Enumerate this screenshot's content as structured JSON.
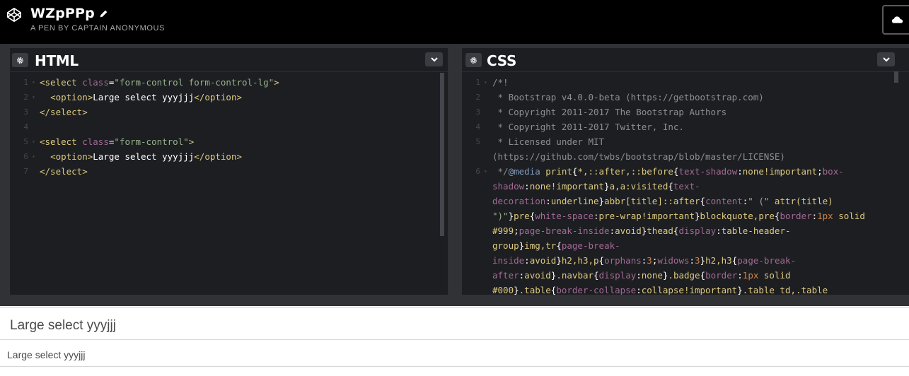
{
  "header": {
    "title": "WZpPPp",
    "subtitle": "A PEN BY CAPTAIN ANONYMOUS"
  },
  "html_pane": {
    "title": "HTML",
    "lines": [
      {
        "n": "1",
        "fold": "▾",
        "segs": [
          [
            "tag",
            "<select "
          ],
          [
            "attr",
            "class"
          ],
          [
            "plain",
            "="
          ],
          [
            "val",
            "\"form-control form-control-lg\""
          ],
          [
            "tag",
            ">"
          ]
        ]
      },
      {
        "n": "2",
        "fold": "▾",
        "segs": [
          [
            "plain",
            "  "
          ],
          [
            "tag",
            "<option>"
          ],
          [
            "plain",
            "Large select yyyjjj"
          ],
          [
            "tag",
            "</option>"
          ]
        ]
      },
      {
        "n": "3",
        "fold": "",
        "segs": [
          [
            "tag",
            "</select>"
          ]
        ]
      },
      {
        "n": "4",
        "fold": "",
        "segs": []
      },
      {
        "n": "5",
        "fold": "▾",
        "segs": [
          [
            "tag",
            "<select "
          ],
          [
            "attr",
            "class"
          ],
          [
            "plain",
            "="
          ],
          [
            "val",
            "\"form-control\""
          ],
          [
            "tag",
            ">"
          ]
        ]
      },
      {
        "n": "6",
        "fold": "▾",
        "segs": [
          [
            "plain",
            "  "
          ],
          [
            "tag",
            "<option>"
          ],
          [
            "plain",
            "Large select yyyjjj"
          ],
          [
            "tag",
            "</option>"
          ]
        ]
      },
      {
        "n": "7",
        "fold": "",
        "segs": [
          [
            "tag",
            "</select>"
          ]
        ]
      }
    ]
  },
  "css_pane": {
    "title": "CSS",
    "lines": [
      {
        "n": "1",
        "fold": "▾",
        "segs": [
          [
            "com",
            "/*!"
          ]
        ]
      },
      {
        "n": "2",
        "fold": "",
        "segs": [
          [
            "com",
            " * Bootstrap v4.0.0-beta (https://getbootstrap.com)"
          ]
        ]
      },
      {
        "n": "3",
        "fold": "",
        "segs": [
          [
            "com",
            " * Copyright 2011-2017 The Bootstrap Authors"
          ]
        ]
      },
      {
        "n": "4",
        "fold": "",
        "segs": [
          [
            "com",
            " * Copyright 2011-2017 Twitter, Inc."
          ]
        ]
      },
      {
        "n": "5",
        "fold": "",
        "segs": [
          [
            "com",
            " * Licensed under MIT"
          ]
        ]
      },
      {
        "n": "",
        "fold": "",
        "segs": [
          [
            "com",
            "(https://github.com/twbs/bootstrap/blob/master/LICENSE)"
          ]
        ]
      },
      {
        "n": "6",
        "fold": "▾",
        "segs": [
          [
            "com",
            " */"
          ],
          [
            "kw",
            "@media"
          ],
          [
            "plain",
            " "
          ],
          [
            "sel",
            "print"
          ],
          [
            "plain",
            "{"
          ],
          [
            "sel",
            "*,::after,::before"
          ],
          [
            "plain",
            "{"
          ],
          [
            "prop",
            "text-shadow"
          ],
          [
            "plain",
            ":"
          ],
          [
            "sel",
            "none!important"
          ],
          [
            "plain",
            ";"
          ],
          [
            "prop",
            "box-"
          ]
        ]
      },
      {
        "n": "",
        "fold": "",
        "segs": [
          [
            "prop",
            "shadow"
          ],
          [
            "plain",
            ":"
          ],
          [
            "sel",
            "none!important"
          ],
          [
            "plain",
            "}"
          ],
          [
            "sel",
            "a,a:visited"
          ],
          [
            "plain",
            "{"
          ],
          [
            "prop",
            "text-"
          ]
        ]
      },
      {
        "n": "",
        "fold": "",
        "segs": [
          [
            "prop",
            "decoration"
          ],
          [
            "plain",
            ":"
          ],
          [
            "sel",
            "underline"
          ],
          [
            "plain",
            "}"
          ],
          [
            "sel",
            "abbr[title]::after"
          ],
          [
            "plain",
            "{"
          ],
          [
            "prop",
            "content"
          ],
          [
            "plain",
            ":"
          ],
          [
            "val",
            "\" (\""
          ],
          [
            "plain",
            " "
          ],
          [
            "sel",
            "attr(title)"
          ]
        ]
      },
      {
        "n": "",
        "fold": "",
        "segs": [
          [
            "val",
            "\")\""
          ],
          [
            "plain",
            "}"
          ],
          [
            "sel",
            "pre"
          ],
          [
            "plain",
            "{"
          ],
          [
            "prop",
            "white-space"
          ],
          [
            "plain",
            ":"
          ],
          [
            "sel",
            "pre-wrap!important"
          ],
          [
            "plain",
            "}"
          ],
          [
            "sel",
            "blockquote,pre"
          ],
          [
            "plain",
            "{"
          ],
          [
            "prop",
            "border"
          ],
          [
            "plain",
            ":"
          ],
          [
            "num",
            "1px"
          ],
          [
            "plain",
            " "
          ],
          [
            "sel",
            "solid"
          ]
        ]
      },
      {
        "n": "",
        "fold": "",
        "segs": [
          [
            "sel",
            "#999"
          ],
          [
            "plain",
            ";"
          ],
          [
            "prop",
            "page-break-inside"
          ],
          [
            "plain",
            ":"
          ],
          [
            "sel",
            "avoid"
          ],
          [
            "plain",
            "}"
          ],
          [
            "sel",
            "thead"
          ],
          [
            "plain",
            "{"
          ],
          [
            "prop",
            "display"
          ],
          [
            "plain",
            ":"
          ],
          [
            "sel",
            "table-header-"
          ]
        ]
      },
      {
        "n": "",
        "fold": "",
        "segs": [
          [
            "sel",
            "group"
          ],
          [
            "plain",
            "}"
          ],
          [
            "sel",
            "img,tr"
          ],
          [
            "plain",
            "{"
          ],
          [
            "prop",
            "page-break-"
          ]
        ]
      },
      {
        "n": "",
        "fold": "",
        "segs": [
          [
            "prop",
            "inside"
          ],
          [
            "plain",
            ":"
          ],
          [
            "sel",
            "avoid"
          ],
          [
            "plain",
            "}"
          ],
          [
            "sel",
            "h2,h3,p"
          ],
          [
            "plain",
            "{"
          ],
          [
            "prop",
            "orphans"
          ],
          [
            "plain",
            ":"
          ],
          [
            "num",
            "3"
          ],
          [
            "plain",
            ";"
          ],
          [
            "prop",
            "widows"
          ],
          [
            "plain",
            ":"
          ],
          [
            "num",
            "3"
          ],
          [
            "plain",
            "}"
          ],
          [
            "sel",
            "h2,h3"
          ],
          [
            "plain",
            "{"
          ],
          [
            "prop",
            "page-break-"
          ]
        ]
      },
      {
        "n": "",
        "fold": "",
        "segs": [
          [
            "prop",
            "after"
          ],
          [
            "plain",
            ":"
          ],
          [
            "sel",
            "avoid"
          ],
          [
            "plain",
            "}"
          ],
          [
            "sel",
            ".navbar"
          ],
          [
            "plain",
            "{"
          ],
          [
            "prop",
            "display"
          ],
          [
            "plain",
            ":"
          ],
          [
            "sel",
            "none"
          ],
          [
            "plain",
            "}"
          ],
          [
            "sel",
            ".badge"
          ],
          [
            "plain",
            "{"
          ],
          [
            "prop",
            "border"
          ],
          [
            "plain",
            ":"
          ],
          [
            "num",
            "1px"
          ],
          [
            "plain",
            " "
          ],
          [
            "sel",
            "solid"
          ]
        ]
      },
      {
        "n": "",
        "fold": "",
        "segs": [
          [
            "sel",
            "#000"
          ],
          [
            "plain",
            "}"
          ],
          [
            "sel",
            ".table"
          ],
          [
            "plain",
            "{"
          ],
          [
            "prop",
            "border-collapse"
          ],
          [
            "plain",
            ":"
          ],
          [
            "sel",
            "collapse!important"
          ],
          [
            "plain",
            "}"
          ],
          [
            "sel",
            ".table td,.table"
          ]
        ]
      }
    ]
  },
  "preview": {
    "select_large": "Large select yyyjjj",
    "select_normal": "Large select yyyjjj"
  }
}
